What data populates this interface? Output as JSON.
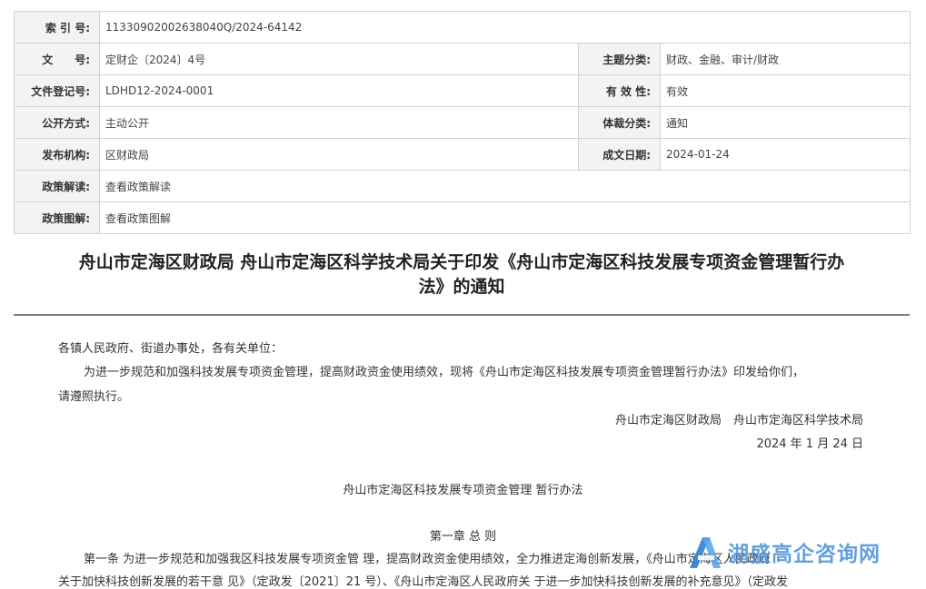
{
  "meta": {
    "index_no": {
      "label": "索 引 号:",
      "value": "11330902002638040Q/2024-64142"
    },
    "doc_no": {
      "label": "文　　号:",
      "value": "定财企〔2024〕4号"
    },
    "topic": {
      "label": "主题分类:",
      "value": "财政、金融、审计/财政"
    },
    "reg_no": {
      "label": "文件登记号:",
      "value": "LDHD12-2024-0001"
    },
    "validity": {
      "label": "有 效 性:",
      "value": "有效"
    },
    "disclosure": {
      "label": "公开方式:",
      "value": "主动公开"
    },
    "genre": {
      "label": "体裁分类:",
      "value": "通知"
    },
    "issuer": {
      "label": "发布机构:",
      "value": "区财政局"
    },
    "date": {
      "label": "成文日期:",
      "value": "2024-01-24"
    },
    "interpretation": {
      "label": "政策解读:",
      "value": "查看政策解读"
    },
    "diagram": {
      "label": "政策图解:",
      "value": "查看政策图解"
    }
  },
  "title": {
    "line1": "舟山市定海区财政局 舟山市定海区科学技术局关于印发《舟山市定海区科技发展专项资金管理暂行办",
    "line2": "法》的通知"
  },
  "body": {
    "salutation": "各镇人民政府、街道办事处，各有关单位：",
    "para1_line1": "为进一步规范和加强科技发展专项资金管理，提高财政资金使用绩效，现将《舟山市定海区科技发展专项资金管理暂行办法》印发给你们，",
    "para1_line2": "请遵照执行。",
    "signature": "舟山市定海区财政局　舟山市定海区科学技术局",
    "sign_date": "2024 年 1 月 24 日",
    "subtitle": "舟山市定海区科技发展专项资金管理 暂行办法",
    "chapter": "第一章  总 则",
    "article1_line1": "第一条  为进一步规范和加强我区科技发展专项资金管 理，提高财政资金使用绩效，全力推进定海创新发展，",
    "article1_line1_tail": "《舟山市定海区人民政府",
    "article1_line2": "关于加快科技创新发展的若干意 见》（定政发〔2021〕21 号）、《舟山市定海区人民政府关 于进一步加快科技创新发展的补充意见》（定政发"
  },
  "watermark": {
    "text": "湖盛高企咨询网",
    "icon": "letter-a-logo-icon",
    "color": "#4a90d9"
  }
}
